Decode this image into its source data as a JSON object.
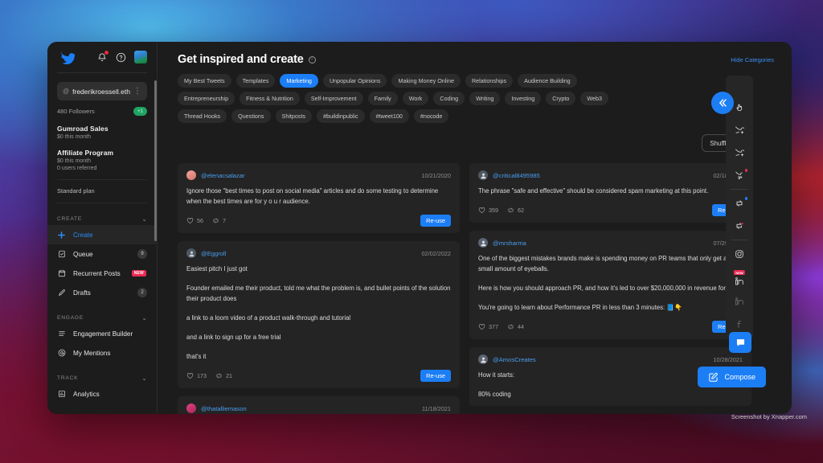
{
  "sidebar": {
    "topbar": {
      "logo": "bird-logo",
      "notifications": "bell-icon",
      "help": "help-icon",
      "avatar": "user-avatar"
    },
    "account": {
      "handle": "frederikroessell.eth",
      "menu": "⋮",
      "followers": "480 Followers",
      "followers_badge": "+1"
    },
    "stats": [
      {
        "title": "Gumroad Sales",
        "lines": [
          "$0 this month"
        ]
      },
      {
        "title": "Affiliate Program",
        "lines": [
          "$0 this month",
          "0 users referred"
        ]
      }
    ],
    "plan": "Standard plan",
    "sections": [
      {
        "label": "CREATE",
        "items": [
          {
            "label": "Create",
            "icon": "plus-icon",
            "active": true,
            "count": ""
          },
          {
            "label": "Queue",
            "icon": "queue-icon",
            "active": false,
            "count": "9"
          },
          {
            "label": "Recurrent Posts",
            "icon": "calendar-icon",
            "active": false,
            "count": "",
            "badge": "NEW"
          },
          {
            "label": "Drafts",
            "icon": "pencil-icon",
            "active": false,
            "count": "2"
          }
        ]
      },
      {
        "label": "ENGAGE",
        "items": [
          {
            "label": "Engagement Builder",
            "icon": "list-icon",
            "active": false,
            "count": ""
          },
          {
            "label": "My Mentions",
            "icon": "at-icon",
            "active": false,
            "count": ""
          }
        ]
      },
      {
        "label": "TRACK",
        "items": [
          {
            "label": "Analytics",
            "icon": "chart-icon",
            "active": false,
            "count": ""
          }
        ]
      }
    ]
  },
  "header": {
    "title": "Get inspired and create",
    "info_icon": "info-icon",
    "hide_categories": "Hide Categories"
  },
  "categories": [
    {
      "label": "My Best Tweets",
      "selected": false
    },
    {
      "label": "Templates",
      "selected": false
    },
    {
      "label": "Marketing",
      "selected": true
    },
    {
      "label": "Unpopular Opinions",
      "selected": false
    },
    {
      "label": "Making Money Online",
      "selected": false
    },
    {
      "label": "Relationships",
      "selected": false
    },
    {
      "label": "Audience Building",
      "selected": false
    },
    {
      "label": "Entrepreneurship",
      "selected": false
    },
    {
      "label": "Fitness & Nutrition",
      "selected": false
    },
    {
      "label": "Self-Improvement",
      "selected": false
    },
    {
      "label": "Family",
      "selected": false
    },
    {
      "label": "Work",
      "selected": false
    },
    {
      "label": "Coding",
      "selected": false
    },
    {
      "label": "Writing",
      "selected": false
    },
    {
      "label": "Investing",
      "selected": false
    },
    {
      "label": "Crypto",
      "selected": false
    },
    {
      "label": "Web3",
      "selected": false
    },
    {
      "label": "Thread Hooks",
      "selected": false
    },
    {
      "label": "Questions",
      "selected": false
    },
    {
      "label": "Shitposts",
      "selected": false
    },
    {
      "label": "#buildinpublic",
      "selected": false
    },
    {
      "label": "#tweet100",
      "selected": false
    },
    {
      "label": "#nocode",
      "selected": false
    }
  ],
  "shuffle": {
    "label": "Shuffle",
    "icon": "shuffle-icon"
  },
  "columns": [
    {
      "cards": [
        {
          "user": "@elenacsalazar",
          "date": "10/21/2020",
          "avatar": "pink",
          "paragraphs": [
            "Ignore those \"best times to post on social media\" articles and do some testing to determine when the best times are for y o u r audience."
          ],
          "likes": "56",
          "retweets": "7",
          "reuse": "Re-use"
        },
        {
          "user": "@Eggroll",
          "date": "02/02/2022",
          "avatar": "dark",
          "paragraphs": [
            "Easiest pitch I just got",
            "Founder emailed me their product, told me what the problem is, and bullet points of the solution their product does",
            "a link to a loom video of a product walk-through and tutorial",
            "and a link to sign up for a free trial",
            "that's it"
          ],
          "likes": "173",
          "retweets": "21",
          "reuse": "Re-use"
        },
        {
          "user": "@thatalliemason",
          "date": "11/18/2021",
          "avatar": "rose",
          "paragraphs": [],
          "likes": "",
          "retweets": "",
          "reuse": ""
        }
      ]
    },
    {
      "cards": [
        {
          "user": "@critical8495985",
          "date": "02/18/2022",
          "avatar": "dark",
          "paragraphs": [
            "The phrase \"safe and effective\" should be considered spam marketing at this point."
          ],
          "likes": "359",
          "retweets": "62",
          "reuse": "Re-use"
        },
        {
          "user": "@mrsharma",
          "date": "07/29/2021",
          "avatar": "grey",
          "paragraphs": [
            "One of the biggest mistakes brands make is spending money on PR teams that only get a small amount of eyeballs.",
            "Here is how you should approach PR, and how it's led to over $20,000,000 in revenue for me.",
            "You're going to learn about Performance PR in less than 3 minutes: 📘👇"
          ],
          "likes": "377",
          "retweets": "44",
          "reuse": "Re-use"
        },
        {
          "user": "@AmosCreates",
          "date": "10/28/2021",
          "avatar": "grey",
          "paragraphs": [
            "How it starts:",
            "80% coding"
          ],
          "likes": "",
          "retweets": "",
          "reuse": ""
        }
      ]
    }
  ],
  "rail": {
    "collapse_icon": "chevron-double-left-icon",
    "items": [
      {
        "icon": "hand-pointer-icon",
        "dim": false,
        "dot": "",
        "badge": ""
      },
      {
        "icon": "tweet-add-icon",
        "dim": false,
        "dot": "",
        "badge": ""
      },
      {
        "icon": "tweet-add-alt-icon",
        "dim": false,
        "dot": "",
        "badge": ""
      },
      {
        "icon": "tweet-pointer-icon",
        "dim": false,
        "dot": "#ea2a54",
        "badge": ""
      },
      {
        "icon": "retweet-icon",
        "dim": false,
        "dot": "#1c7ef5",
        "badge": ""
      },
      {
        "icon": "retweet-close-icon",
        "dim": false,
        "dot": "#ea2a54",
        "badge": ""
      },
      {
        "icon": "instagram-icon",
        "dim": false,
        "dot": "",
        "badge": ""
      },
      {
        "icon": "linkedin-icon",
        "dim": false,
        "dot": "",
        "badge": "NEW"
      },
      {
        "icon": "linkedin-dim-icon",
        "dim": true,
        "dot": "",
        "badge": ""
      },
      {
        "icon": "facebook-icon",
        "dim": true,
        "dot": "",
        "badge": ""
      }
    ]
  },
  "fab": {
    "chat_icon": "chat-icon",
    "compose_label": "Compose",
    "compose_icon": "compose-icon"
  },
  "watermark": "Screenshot by Xnapper.com",
  "colors": {
    "accent": "#1c7ef5",
    "link": "#4a9ef0",
    "badge_new": "#ea2a54",
    "window_bg": "#1c1c1c",
    "card_bg": "#242424"
  }
}
